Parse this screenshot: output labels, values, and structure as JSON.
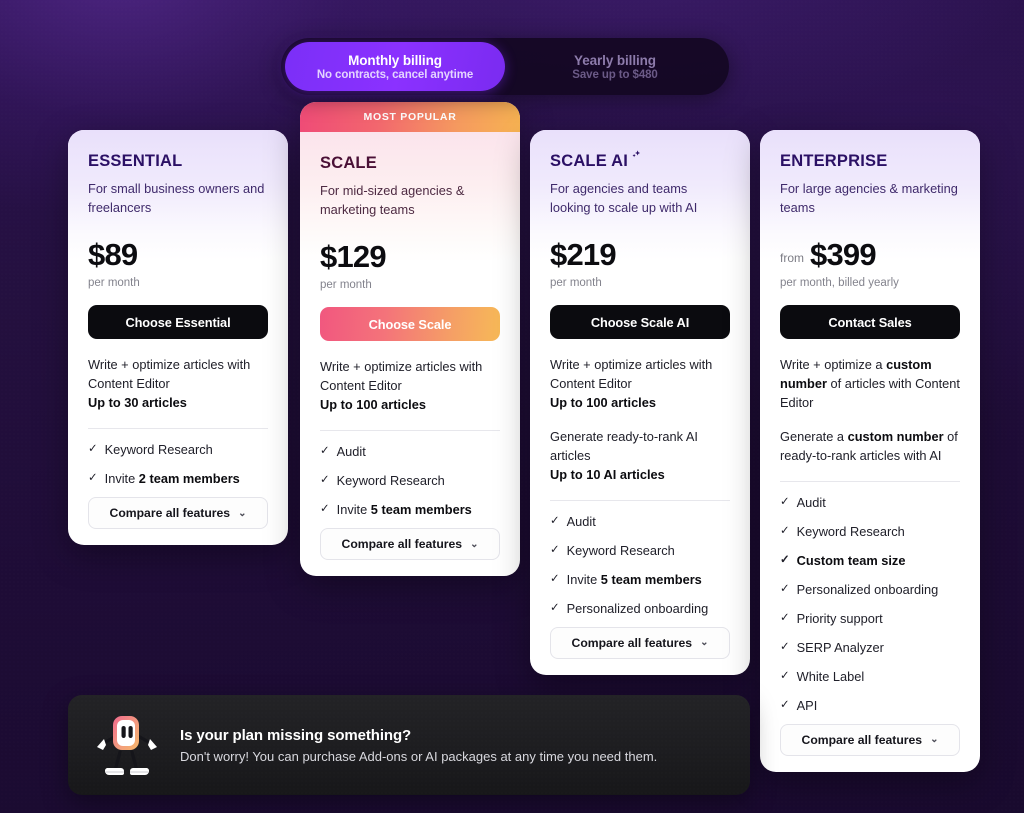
{
  "billing_toggle": {
    "monthly": {
      "title": "Monthly billing",
      "subtitle": "No contracts, cancel anytime"
    },
    "yearly": {
      "title": "Yearly billing",
      "subtitle": "Save up to $480"
    },
    "active": "monthly",
    "active_color": "#7b2ff7"
  },
  "popular_badge": "MOST POPULAR",
  "compare_label": "Compare all features",
  "chevron": "⌄",
  "check": "✓",
  "plans": [
    {
      "name": "ESSENTIAL",
      "description": "For small business owners and freelancers",
      "price": "$89",
      "price_prefix": "",
      "period": "per month",
      "cta": "Choose Essential",
      "blurbs": [
        {
          "text": "Write + optimize articles with Content Editor",
          "bold_tail": "Up to 30 articles"
        }
      ],
      "features": [
        {
          "label": "Keyword Research"
        },
        {
          "label": "Invite ",
          "bold": "2 team members"
        }
      ]
    },
    {
      "name": "SCALE",
      "description": "For mid-sized agencies & marketing teams",
      "price": "$129",
      "price_prefix": "",
      "period": "per month",
      "cta": "Choose Scale",
      "blurbs": [
        {
          "text": "Write + optimize articles with Content Editor",
          "bold_tail": "Up to 100 articles"
        }
      ],
      "features": [
        {
          "label": "Audit"
        },
        {
          "label": "Keyword Research"
        },
        {
          "label": "Invite ",
          "bold": "5 team members"
        }
      ]
    },
    {
      "name": "SCALE AI",
      "name_icon": "sparkles-icon",
      "description": "For agencies and teams looking to scale up with AI",
      "price": "$219",
      "price_prefix": "",
      "period": "per month",
      "cta": "Choose Scale AI",
      "blurbs": [
        {
          "text": "Write + optimize articles with Content Editor",
          "bold_tail": "Up to 100 articles"
        },
        {
          "text": "Generate ready-to-rank AI articles",
          "bold_tail": "Up to 10 AI articles"
        }
      ],
      "features": [
        {
          "label": "Audit"
        },
        {
          "label": "Keyword Research"
        },
        {
          "label": "Invite ",
          "bold": "5 team members"
        },
        {
          "label": "Personalized onboarding"
        }
      ]
    },
    {
      "name": "ENTERPRISE",
      "description": "For large agencies & marketing teams",
      "price": "$399",
      "price_prefix": "from",
      "period": "per month, billed yearly",
      "cta": "Contact Sales",
      "blurbs": [
        {
          "text_a": "Write + optimize a ",
          "bold_mid": "custom number",
          "text_b": " of articles with Content Editor"
        },
        {
          "text_a": "Generate a ",
          "bold_mid": "custom number",
          "text_b": " of ready-to-rank articles with AI"
        }
      ],
      "features": [
        {
          "label": "Audit"
        },
        {
          "label": "Keyword Research"
        },
        {
          "label": "Custom team size",
          "all_bold": true
        },
        {
          "label": "Personalized onboarding"
        },
        {
          "label": "Priority support"
        },
        {
          "label": "SERP Analyzer"
        },
        {
          "label": "White Label"
        },
        {
          "label": "API"
        }
      ]
    }
  ],
  "addon_banner": {
    "title": "Is your plan missing something?",
    "subtitle": "Don't worry! You can purchase Add-ons or AI packages at any time you need them.",
    "mascot": "robot-mascot-icon"
  }
}
